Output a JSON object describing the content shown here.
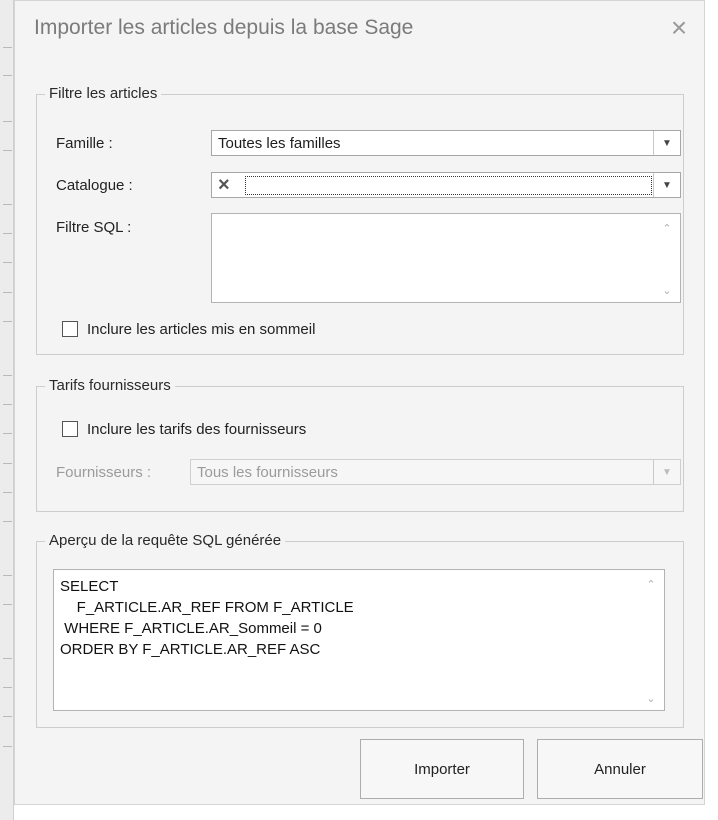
{
  "dialog": {
    "title": "Importer les articles depuis la base Sage",
    "close_glyph": "×"
  },
  "filter_group": {
    "title": "Filtre les articles",
    "famille_label": "Famille :",
    "famille_value": "Toutes les familles",
    "catalogue_label": "Catalogue :",
    "catalogue_value": "",
    "catalogue_clear_glyph": "×",
    "sql_label": "Filtre SQL :",
    "sql_value": "",
    "include_sleeping_label": "Inclure les articles mis en sommeil",
    "include_sleeping_checked": false
  },
  "supplier_group": {
    "title": "Tarifs fournisseurs",
    "include_label": "Inclure les tarifs des fournisseurs",
    "include_checked": false,
    "suppliers_label": "Fournisseurs :",
    "suppliers_value": "Tous les fournisseurs"
  },
  "preview_group": {
    "title": "Aperçu de la requête SQL générée",
    "sql": "SELECT\n    F_ARTICLE.AR_REF FROM F_ARTICLE\n WHERE F_ARTICLE.AR_Sommeil = 0\nORDER BY F_ARTICLE.AR_REF ASC"
  },
  "buttons": {
    "import_label": "Importer",
    "cancel_label": "Annuler"
  },
  "glyphs": {
    "dropdown": "▼",
    "scroll_up": "⌃",
    "scroll_down": "⌄"
  },
  "icons": {
    "close": "close-icon",
    "dropdown": "chevron-down-icon",
    "clear": "clear-icon"
  }
}
